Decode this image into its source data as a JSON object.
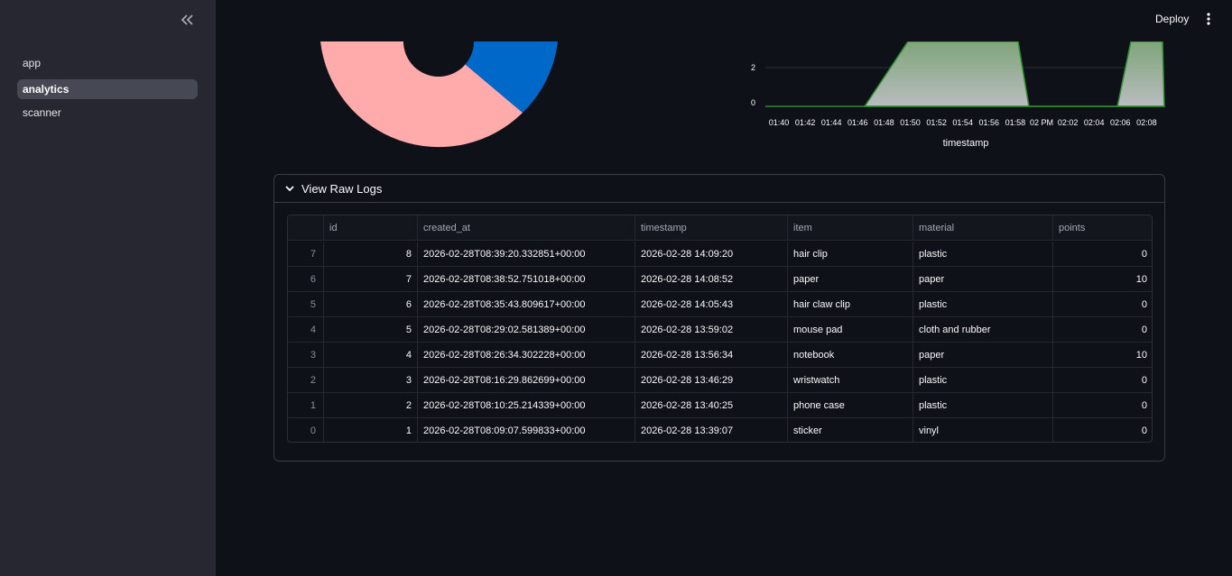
{
  "sidebar": {
    "items": [
      {
        "label": "app",
        "active": false
      },
      {
        "label": "analytics",
        "active": true
      },
      {
        "label": "scanner",
        "active": false
      }
    ]
  },
  "header": {
    "deploy_label": "Deploy"
  },
  "pie_chart": {
    "slices": [
      {
        "color": "#ffabab",
        "share": 0.72
      },
      {
        "color": "#0068c9",
        "share": 0.28
      }
    ]
  },
  "area_chart": {
    "xlabel": "timestamp",
    "y_ticks": [
      "0",
      "2"
    ],
    "x_ticks": [
      "01:40",
      "01:42",
      "01:44",
      "01:46",
      "01:48",
      "01:50",
      "01:52",
      "01:54",
      "01:56",
      "01:58",
      "02 PM",
      "02:02",
      "02:04",
      "02:06",
      "02:08"
    ],
    "fill_color": "#8fb08a",
    "line_color": "#2e8b2e"
  },
  "expander": {
    "title": "View Raw Logs",
    "expanded": true
  },
  "table": {
    "columns": [
      "",
      "id",
      "created_at",
      "timestamp",
      "item",
      "material",
      "points"
    ],
    "rows": [
      [
        "7",
        "8",
        "2026-02-28T08:39:20.332851+00:00",
        "2026-02-28 14:09:20",
        "hair clip",
        "plastic",
        "0"
      ],
      [
        "6",
        "7",
        "2026-02-28T08:38:52.751018+00:00",
        "2026-02-28 14:08:52",
        "paper",
        "paper",
        "10"
      ],
      [
        "5",
        "6",
        "2026-02-28T08:35:43.809617+00:00",
        "2026-02-28 14:05:43",
        "hair claw clip",
        "plastic",
        "0"
      ],
      [
        "4",
        "5",
        "2026-02-28T08:29:02.581389+00:00",
        "2026-02-28 13:59:02",
        "mouse pad",
        "cloth and rubber",
        "0"
      ],
      [
        "3",
        "4",
        "2026-02-28T08:26:34.302228+00:00",
        "2026-02-28 13:56:34",
        "notebook",
        "paper",
        "10"
      ],
      [
        "2",
        "3",
        "2026-02-28T08:16:29.862699+00:00",
        "2026-02-28 13:46:29",
        "wristwatch",
        "plastic",
        "0"
      ],
      [
        "1",
        "2",
        "2026-02-28T08:10:25.214339+00:00",
        "2026-02-28 13:40:25",
        "phone case",
        "plastic",
        "0"
      ],
      [
        "0",
        "1",
        "2026-02-28T08:09:07.599833+00:00",
        "2026-02-28 13:39:07",
        "sticker",
        "vinyl",
        "0"
      ]
    ]
  }
}
